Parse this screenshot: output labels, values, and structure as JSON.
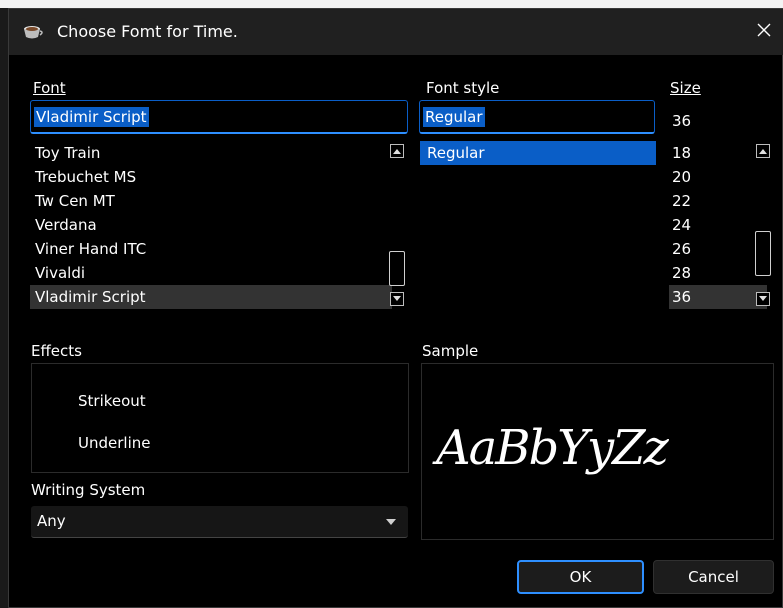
{
  "window": {
    "title": "Choose Fomt for Time."
  },
  "font": {
    "label": "Font",
    "value": "Vladimir Script",
    "items": [
      "Toy Train",
      "Trebuchet MS",
      "Tw Cen MT",
      "Verdana",
      "Viner Hand ITC",
      "Vivaldi",
      "Vladimir Script"
    ],
    "selected_index": 6
  },
  "font_style": {
    "label": "Font style",
    "value": "Regular",
    "items": [
      "Regular"
    ]
  },
  "size": {
    "label": "Size",
    "value": "36",
    "items": [
      "18",
      "20",
      "22",
      "24",
      "26",
      "28",
      "36"
    ],
    "selected_index": 6
  },
  "effects": {
    "label": "Effects",
    "strikeout": "Strikeout",
    "underline": "Underline"
  },
  "writing_system": {
    "label": "Writing System",
    "value": "Any"
  },
  "sample": {
    "label": "Sample",
    "text": "AaBbYyZz"
  },
  "buttons": {
    "ok": "OK",
    "cancel": "Cancel"
  },
  "colors": {
    "accent": "#0a5ec7",
    "focus": "#2e8fff",
    "background": "#000000",
    "titlebar": "#202020"
  }
}
